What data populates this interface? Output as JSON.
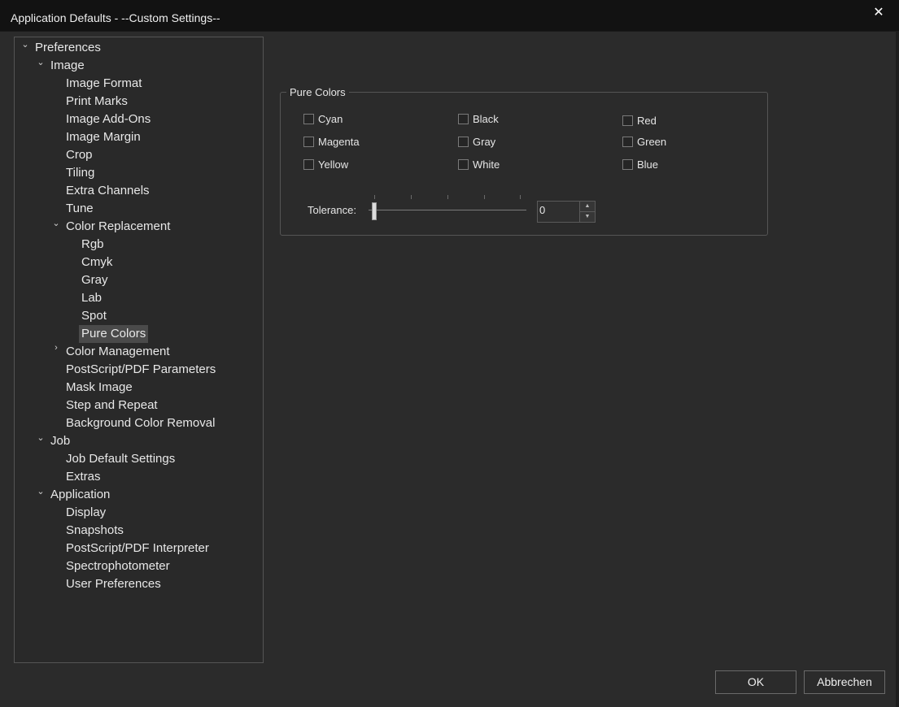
{
  "window": {
    "title": "Application Defaults - --Custom Settings--",
    "close_icon": "✕"
  },
  "tree": {
    "collapse_icon": "⌄",
    "expand_icon": "›",
    "root": "Preferences",
    "image": "Image",
    "image_children": [
      "Image Format",
      "Print Marks",
      "Image Add-Ons",
      "Image Margin",
      "Crop",
      "Tiling",
      "Extra Channels",
      "Tune"
    ],
    "color_replacement": "Color Replacement",
    "color_replacement_children": [
      "Rgb",
      "Cmyk",
      "Gray",
      "Lab",
      "Spot",
      "Pure Colors"
    ],
    "color_management": "Color Management",
    "image_children_after": [
      "PostScript/PDF Parameters",
      "Mask Image",
      "Step and Repeat",
      "Background Color Removal"
    ],
    "job": "Job",
    "job_children": [
      "Job Default Settings",
      "Extras"
    ],
    "application": "Application",
    "application_children": [
      "Display",
      "Snapshots",
      "PostScript/PDF Interpreter",
      "Spectrophotometer",
      "User Preferences"
    ],
    "selected": "Pure Colors"
  },
  "pure_colors": {
    "title": "Pure Colors",
    "checkboxes": [
      {
        "label": "Cyan",
        "checked": false
      },
      {
        "label": "Magenta",
        "checked": false
      },
      {
        "label": "Yellow",
        "checked": false
      },
      {
        "label": "Black",
        "checked": false
      },
      {
        "label": "Gray",
        "checked": false
      },
      {
        "label": "White",
        "checked": false
      },
      {
        "label": "Red",
        "checked": false
      },
      {
        "label": "Green",
        "checked": false
      },
      {
        "label": "Blue",
        "checked": false
      }
    ],
    "tolerance_label": "Tolerance:",
    "tolerance_value": "0",
    "spin_up_icon": "▲",
    "spin_down_icon": "▼"
  },
  "buttons": {
    "ok": "OK",
    "cancel": "Abbrechen"
  }
}
